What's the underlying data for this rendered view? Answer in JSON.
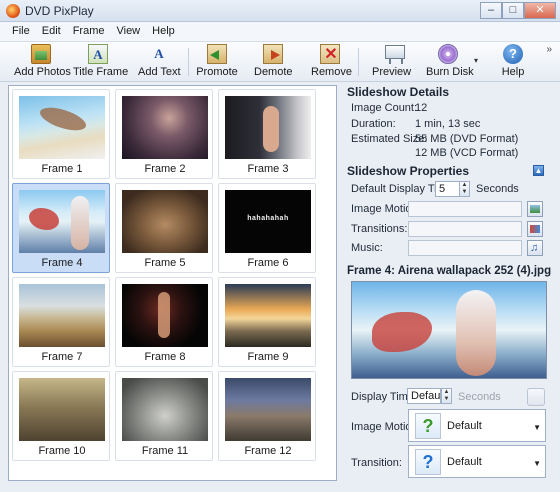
{
  "window": {
    "title": "DVD PixPlay",
    "minimize": "–",
    "maximize": "□",
    "close": "✕"
  },
  "menu": [
    "File",
    "Edit",
    "Frame",
    "View",
    "Help"
  ],
  "toolbar": {
    "add_photos": "Add Photos",
    "title_frame": "Title Frame",
    "add_text": "Add Text",
    "promote": "Promote",
    "demote": "Demote",
    "remove": "Remove",
    "preview": "Preview",
    "burn_disk": "Burn Disk",
    "help": "Help",
    "overflow": "»",
    "burn_dropdown": "▾"
  },
  "frames": [
    {
      "label": "Frame 1"
    },
    {
      "label": "Frame 2"
    },
    {
      "label": "Frame 3"
    },
    {
      "label": "Frame 4",
      "selected": true
    },
    {
      "label": "Frame 5"
    },
    {
      "label": "Frame 6",
      "thumb_text": "hahahahah"
    },
    {
      "label": "Frame 7"
    },
    {
      "label": "Frame 8"
    },
    {
      "label": "Frame 9"
    },
    {
      "label": "Frame 10"
    },
    {
      "label": "Frame 11"
    },
    {
      "label": "Frame 12"
    }
  ],
  "details": {
    "title": "Slideshow Details",
    "image_count_label": "Image Count:",
    "image_count": "12",
    "duration_label": "Duration:",
    "duration": "1 min, 13 sec",
    "estimated_size_label": "Estimated Size:",
    "size_dvd": "55 MB (DVD Format)",
    "size_vcd": "12 MB (VCD Format)"
  },
  "properties": {
    "title": "Slideshow Properties",
    "collapse": "▲",
    "default_display_time_label": "Default Display Time:",
    "default_display_time": "5",
    "seconds": "Seconds",
    "image_motion_label": "Image Motion:",
    "transitions_label": "Transitions:",
    "music_label": "Music:"
  },
  "frame_detail": {
    "title": "Frame 4: Airena wallapack 252 (4).jpg",
    "display_time_label": "Display Time:",
    "display_time": "Default",
    "seconds": "Seconds",
    "image_motion_label": "Image Motion:",
    "image_motion_value": "Default",
    "transition_label": "Transition:",
    "transition_value": "Default",
    "question_mark": "?",
    "dropdown_arrow": "▼"
  },
  "colors": {
    "selection": "#c9ddf7",
    "accent": "#2e6bbf",
    "question_green": "#3a9a2a",
    "question_blue": "#1f6fd0"
  },
  "icons": {
    "spin_up": "▲",
    "spin_down": "▼"
  }
}
